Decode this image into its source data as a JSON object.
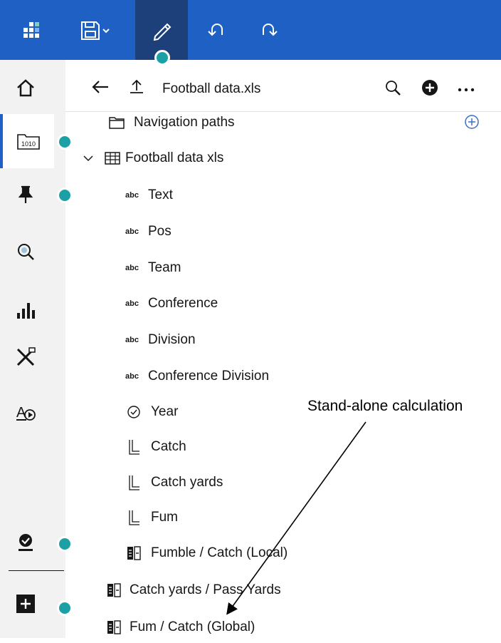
{
  "toolbar": {
    "app_icon": "dashboard-grid-icon",
    "save_icon": "save-icon",
    "edit_icon": "pencil-icon",
    "undo_icon": "undo-icon",
    "redo_icon": "redo-icon",
    "accent_color": "#1f60c4"
  },
  "leftnav": {
    "items": [
      {
        "icon": "home-icon"
      },
      {
        "icon": "data-source-icon"
      },
      {
        "icon": "pin-icon"
      },
      {
        "icon": "explore-icon"
      },
      {
        "icon": "visualizations-icon"
      },
      {
        "icon": "tools-icon"
      },
      {
        "icon": "text-media-icon"
      },
      {
        "icon": "user-check-icon"
      },
      {
        "icon": "add-icon"
      }
    ]
  },
  "panel": {
    "header": {
      "title": "Football data.xls",
      "back_icon": "arrow-left-icon",
      "upload_icon": "upload-icon",
      "search_icon": "search-icon",
      "add_icon": "add-circle-icon",
      "more_icon": "overflow-menu-icon"
    },
    "tree": [
      {
        "label": "Navigation paths",
        "icon": "folder-icon"
      },
      {
        "label": "Football data xls",
        "icon": "table-icon"
      },
      {
        "label": "Text",
        "type": "abc"
      },
      {
        "label": "Pos",
        "type": "abc"
      },
      {
        "label": "Team",
        "type": "abc"
      },
      {
        "label": "Conference",
        "type": "abc"
      },
      {
        "label": "Division",
        "type": "abc"
      },
      {
        "label": "Conference Division",
        "type": "abc"
      },
      {
        "label": "Year",
        "icon": "clock-icon"
      },
      {
        "label": "Catch",
        "icon": "measure-icon"
      },
      {
        "label": "Catch yards",
        "icon": "measure-icon"
      },
      {
        "label": "Fum",
        "icon": "measure-icon"
      },
      {
        "label": "Fumble / Catch (Local)",
        "icon": "calculation-icon"
      },
      {
        "label": "Catch yards / Pass Yards",
        "icon": "calculation-icon"
      },
      {
        "label": "Fum / Catch (Global)",
        "icon": "calculation-icon"
      }
    ],
    "abc_label": "abc"
  },
  "annotation": {
    "text": "Stand-alone calculation"
  }
}
